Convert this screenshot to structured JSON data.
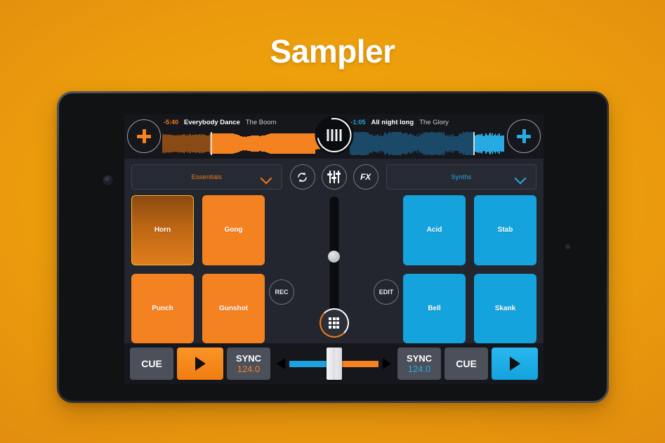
{
  "page": {
    "title": "Sampler"
  },
  "decks": {
    "left": {
      "time": "-5:40",
      "track_title": "Everybody Dance",
      "track_artist": "The Boom",
      "add_label": "+",
      "color": "#f58220",
      "progress_pct": 30
    },
    "right": {
      "time": "-1:05",
      "track_title": "All night long",
      "track_artist": "The Glory",
      "add_label": "+",
      "color": "#29a9e1",
      "progress_pct": 80
    },
    "jog_icon": "vinyl-jog-icon"
  },
  "selector_row": {
    "left_dropdown": {
      "label": "Essentials",
      "chevron": "chevron-down-icon"
    },
    "right_dropdown": {
      "label": "Synths",
      "chevron": "chevron-down-icon"
    },
    "buttons": [
      {
        "name": "loop-icon",
        "label": ""
      },
      {
        "name": "eq-faders-icon",
        "label": ""
      },
      {
        "name": "fx-button",
        "label": "FX"
      }
    ]
  },
  "pads": {
    "left": [
      {
        "label": "Horn",
        "active": true
      },
      {
        "label": "Gong",
        "active": false
      },
      {
        "label": "Punch",
        "active": false
      },
      {
        "label": "Gunshot",
        "active": false
      }
    ],
    "right": [
      {
        "label": "Acid",
        "active": false
      },
      {
        "label": "Stab",
        "active": false
      },
      {
        "label": "Bell",
        "active": false
      },
      {
        "label": "Skank",
        "active": false
      }
    ]
  },
  "center": {
    "fader_value_pct": 44,
    "rec_label": "REC",
    "edit_label": "EDIT",
    "grid_icon": "pad-grid-icon"
  },
  "transport": {
    "left": {
      "cue_label": "CUE",
      "play_icon": "play-icon",
      "sync_label": "SYNC",
      "bpm": "124.0"
    },
    "right": {
      "cue_label": "CUE",
      "play_icon": "play-icon",
      "sync_label": "SYNC",
      "bpm": "124.0"
    },
    "crossfader": {
      "position_pct": 50,
      "left_arrow": "arrow-left-icon",
      "right_arrow": "arrow-right-icon"
    }
  },
  "colors": {
    "orange": "#f58220",
    "blue": "#14a3dc",
    "background_orange": "#eb9c0c",
    "panel": "#23262e",
    "panel_dark": "#15171c"
  }
}
